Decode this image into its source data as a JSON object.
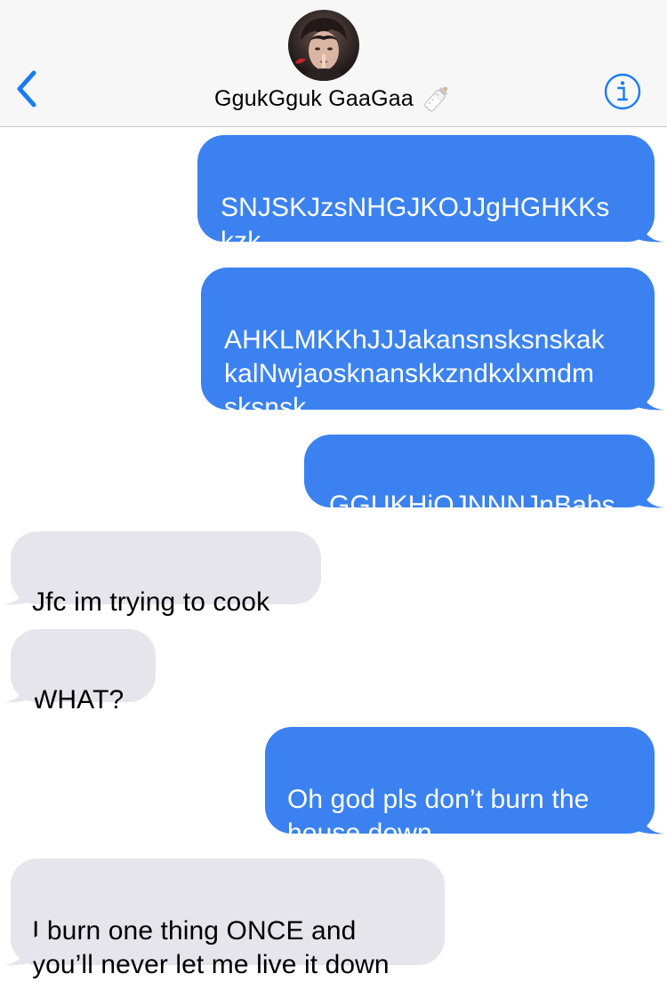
{
  "header": {
    "contact_name": "GgukGguk GaaGaa",
    "back_icon": "chevron-left-icon",
    "info_icon": "info-circle-icon",
    "name_emoji": "baby-bottle-icon",
    "accent_color": "#1a7cf5"
  },
  "messages": [
    {
      "direction": "sent",
      "text": "SNJSKJzsNHGJKOJJgHGHKKs\nkzk"
    },
    {
      "direction": "sent",
      "text": "AHKLMKKhJJJakansnsksnskak\nkalNwjaosknanskkzndkxlxmdm\nsksnsk"
    },
    {
      "direction": "sent",
      "text": "GGUKHjOJNNNJnBabs"
    },
    {
      "direction": "received",
      "text": "Jfc im trying to cook"
    },
    {
      "direction": "received",
      "text": "WHAT?"
    },
    {
      "direction": "sent",
      "text": "Oh god pls don’t burn the\nhouse down"
    },
    {
      "direction": "received",
      "text": "I burn one thing ONCE and\nyou’ll never let me live it down"
    }
  ],
  "colors": {
    "sent_bubble": "#3b82f0",
    "received_bubble": "#e6e5eb",
    "header_bg": "#f7f7f7"
  }
}
